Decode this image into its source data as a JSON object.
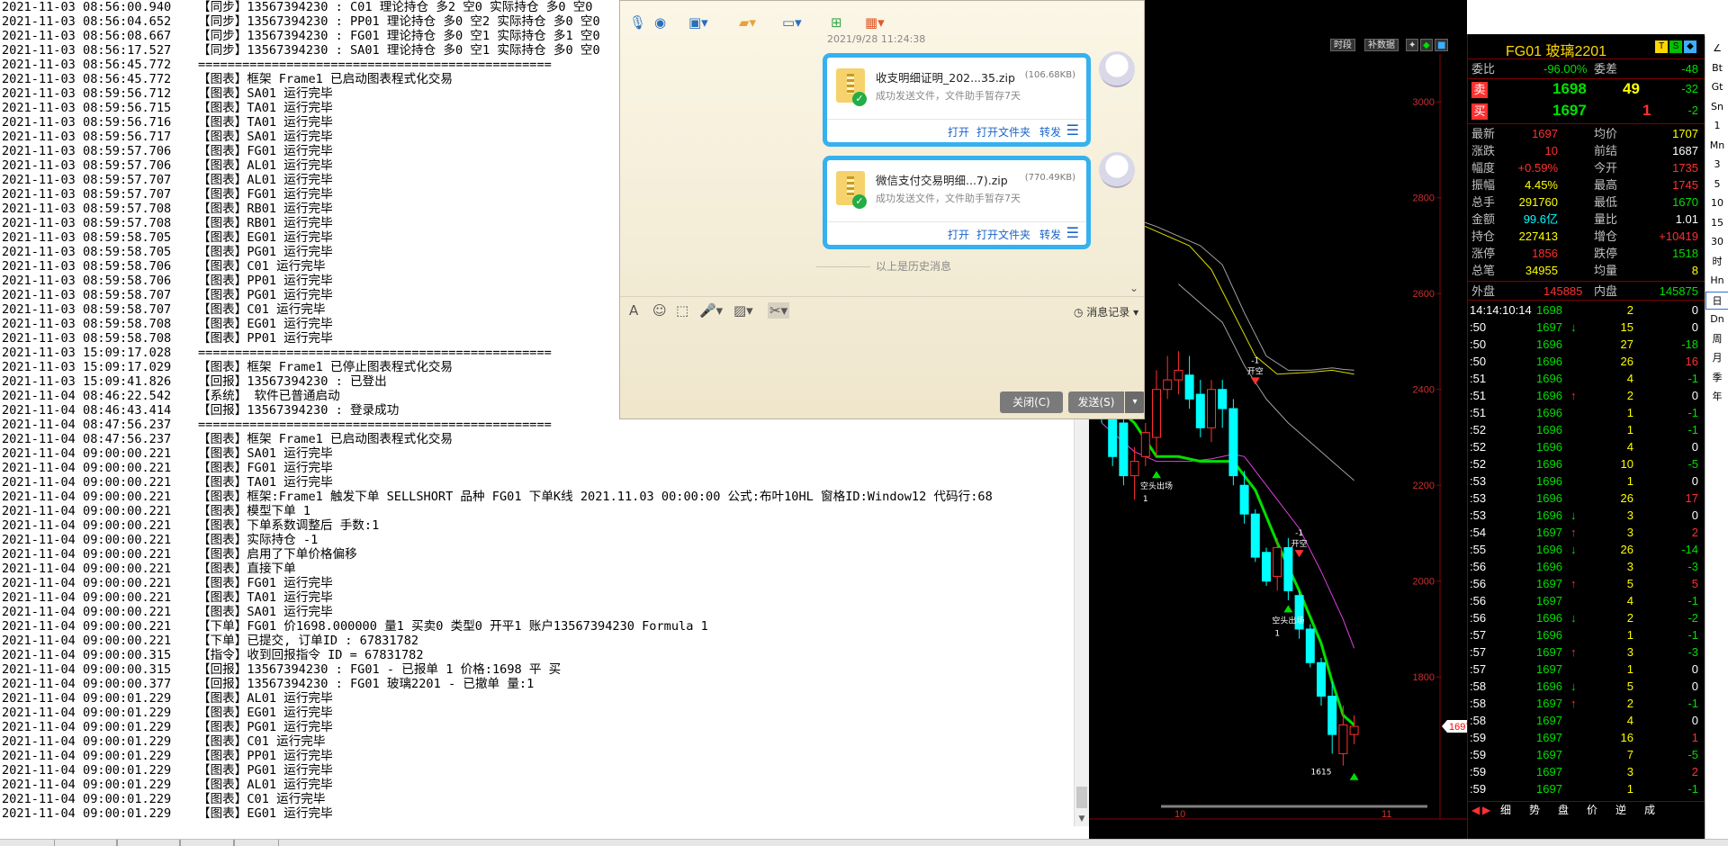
{
  "log": {
    "lines": [
      {
        "ts": "2021-11-03 08:56:00.940",
        "msg": "【同步】13567394230 : C01 理论持仓 多2 空0 实际持仓 多0 空0"
      },
      {
        "ts": "2021-11-03 08:56:04.652",
        "msg": "【同步】13567394230 : PP01 理论持仓 多0 空2 实际持仓 多0 空0"
      },
      {
        "ts": "2021-11-03 08:56:08.667",
        "msg": "【同步】13567394230 : FG01 理论持仓 多0 空1 实际持仓 多1 空0"
      },
      {
        "ts": "2021-11-03 08:56:17.527",
        "msg": "【同步】13567394230 : SA01 理论持仓 多0 空1 实际持仓 多0 空0"
      },
      {
        "ts": "2021-11-03 08:56:45.772",
        "msg": "================================================"
      },
      {
        "ts": "2021-11-03 08:56:45.772",
        "msg": "【图表】框架 Frame1 已启动图表程式化交易"
      },
      {
        "ts": "2021-11-03 08:59:56.712",
        "msg": "【图表】SA01 运行完毕"
      },
      {
        "ts": "2021-11-03 08:59:56.715",
        "msg": "【图表】TA01 运行完毕"
      },
      {
        "ts": "2021-11-03 08:59:56.716",
        "msg": "【图表】TA01 运行完毕"
      },
      {
        "ts": "2021-11-03 08:59:56.717",
        "msg": "【图表】SA01 运行完毕"
      },
      {
        "ts": "2021-11-03 08:59:57.706",
        "msg": "【图表】FG01 运行完毕"
      },
      {
        "ts": "2021-11-03 08:59:57.706",
        "msg": "【图表】AL01 运行完毕"
      },
      {
        "ts": "2021-11-03 08:59:57.707",
        "msg": "【图表】AL01 运行完毕"
      },
      {
        "ts": "2021-11-03 08:59:57.707",
        "msg": "【图表】FG01 运行完毕"
      },
      {
        "ts": "2021-11-03 08:59:57.708",
        "msg": "【图表】RB01 运行完毕"
      },
      {
        "ts": "2021-11-03 08:59:57.708",
        "msg": "【图表】RB01 运行完毕"
      },
      {
        "ts": "2021-11-03 08:59:58.705",
        "msg": "【图表】EG01 运行完毕"
      },
      {
        "ts": "2021-11-03 08:59:58.705",
        "msg": "【图表】PG01 运行完毕"
      },
      {
        "ts": "2021-11-03 08:59:58.706",
        "msg": "【图表】C01 运行完毕"
      },
      {
        "ts": "2021-11-03 08:59:58.706",
        "msg": "【图表】PP01 运行完毕"
      },
      {
        "ts": "2021-11-03 08:59:58.707",
        "msg": "【图表】PG01 运行完毕"
      },
      {
        "ts": "2021-11-03 08:59:58.707",
        "msg": "【图表】C01 运行完毕"
      },
      {
        "ts": "2021-11-03 08:59:58.708",
        "msg": "【图表】EG01 运行完毕"
      },
      {
        "ts": "2021-11-03 08:59:58.708",
        "msg": "【图表】PP01 运行完毕"
      },
      {
        "ts": "2021-11-03 15:09:17.028",
        "msg": "================================================"
      },
      {
        "ts": "2021-11-03 15:09:17.029",
        "msg": "【图表】框架 Frame1 已停止图表程式化交易"
      },
      {
        "ts": "2021-11-03 15:09:41.826",
        "msg": "【回报】13567394230 : 已登出"
      },
      {
        "ts": "2021-11-04 08:46:22.542",
        "msg": "【系统】 软件已普通启动"
      },
      {
        "ts": "2021-11-04 08:46:43.414",
        "msg": "【回报】13567394230 : 登录成功"
      },
      {
        "ts": "2021-11-04 08:47:56.237",
        "msg": "================================================"
      },
      {
        "ts": "2021-11-04 08:47:56.237",
        "msg": "【图表】框架 Frame1 已启动图表程式化交易"
      },
      {
        "ts": "2021-11-04 09:00:00.221",
        "msg": "【图表】SA01 运行完毕"
      },
      {
        "ts": "2021-11-04 09:00:00.221",
        "msg": "【图表】FG01 运行完毕"
      },
      {
        "ts": "2021-11-04 09:00:00.221",
        "msg": "【图表】TA01 运行完毕"
      },
      {
        "ts": "2021-11-04 09:00:00.221",
        "msg": "【图表】框架:Frame1 触发下单 SELLSHORT 品种 FG01 下单K线 2021.11.03 00:00:00 公式:布叶10HL 窗格ID:Window12 代码行:68"
      },
      {
        "ts": "2021-11-04 09:00:00.221",
        "msg": "【图表】模型下单 1"
      },
      {
        "ts": "2021-11-04 09:00:00.221",
        "msg": "【图表】下单系数调整后 手数:1"
      },
      {
        "ts": "2021-11-04 09:00:00.221",
        "msg": "【图表】实际持仓 -1"
      },
      {
        "ts": "2021-11-04 09:00:00.221",
        "msg": "【图表】启用了下单价格偏移"
      },
      {
        "ts": "2021-11-04 09:00:00.221",
        "msg": "【图表】直接下单"
      },
      {
        "ts": "2021-11-04 09:00:00.221",
        "msg": "【图表】FG01 运行完毕"
      },
      {
        "ts": "2021-11-04 09:00:00.221",
        "msg": "【图表】TA01 运行完毕"
      },
      {
        "ts": "2021-11-04 09:00:00.221",
        "msg": "【图表】SA01 运行完毕"
      },
      {
        "ts": "2021-11-04 09:00:00.221",
        "msg": "【下单】FG01 价1698.000000 量1 买卖0 类型0 开平1 账户13567394230 Formula 1"
      },
      {
        "ts": "2021-11-04 09:00:00.221",
        "msg": "【下单】已提交, 订单ID : 67831782"
      },
      {
        "ts": "2021-11-04 09:00:00.315",
        "msg": "【指令】收到回报指令 ID = 67831782"
      },
      {
        "ts": "2021-11-04 09:00:00.315",
        "msg": "【回报】13567394230 : FG01 - 已报单 1 价格:1698 平 买"
      },
      {
        "ts": "2021-11-04 09:00:00.377",
        "msg": "【回报】13567394230 : FG01 玻璃2201 - 已撤单 量:1"
      },
      {
        "ts": "2021-11-04 09:00:01.229",
        "msg": "【图表】AL01 运行完毕"
      },
      {
        "ts": "2021-11-04 09:00:01.229",
        "msg": "【图表】EG01 运行完毕"
      },
      {
        "ts": "2021-11-04 09:00:01.229",
        "msg": "【图表】PG01 运行完毕"
      },
      {
        "ts": "2021-11-04 09:00:01.229",
        "msg": "【图表】C01 运行完毕"
      },
      {
        "ts": "2021-11-04 09:00:01.229",
        "msg": "【图表】PP01 运行完毕"
      },
      {
        "ts": "2021-11-04 09:00:01.229",
        "msg": "【图表】PG01 运行完毕"
      },
      {
        "ts": "2021-11-04 09:00:01.229",
        "msg": "【图表】AL01 运行完毕"
      },
      {
        "ts": "2021-11-04 09:00:01.229",
        "msg": "【图表】C01 运行完毕"
      },
      {
        "ts": "2021-11-04 09:00:01.229",
        "msg": "【图表】EG01 运行完毕"
      }
    ]
  },
  "chat": {
    "date": "2021/9/28 11:24:38",
    "files": [
      {
        "name": "收支明细证明_202...35.zip",
        "size": "(106.68KB)",
        "status": "成功发送文件，文件助手暂存7天"
      },
      {
        "name": "微信支付交易明细...7).zip",
        "size": "(770.49KB)",
        "status": "成功发送文件，文件助手暂存7天"
      }
    ],
    "file_actions": {
      "open": "打开",
      "open_folder": "打开文件夹",
      "forward": "转发"
    },
    "history_note": "以上是历史消息",
    "msg_record": "消息记录",
    "close_label": "关闭(C)",
    "send_label": "发送(S)"
  },
  "chart": {
    "toolbar": {
      "btn1": "时段",
      "btn2": "补数据"
    },
    "price_labels": [
      "3000",
      "2800",
      "2600",
      "2400",
      "2200",
      "2000",
      "1800"
    ],
    "x_labels": [
      "10",
      "11"
    ],
    "current_price_tag": "1697",
    "annotations": {
      "open_short_1": "开空",
      "open_short_2": "开空",
      "cover_1": "空头出场",
      "cover_2": "空头出场",
      "minus1_a": "-1",
      "minus1_b": "-1",
      "one_a": "1",
      "one_b": "1",
      "low_value": "1615"
    },
    "colors": {
      "up": "#ff3030",
      "down": "#00ffff",
      "ma_yellow": "#d8d800",
      "ma_magenta": "#e040e0",
      "ma_gray": "#a0a0a0",
      "ma_green": "#00e000"
    }
  },
  "quote": {
    "title": "FG01  玻璃2201",
    "wb": {
      "label": "委比",
      "pct": "-96.00%",
      "wc_label": "委差",
      "wc": "-48"
    },
    "ask": {
      "label": "卖",
      "price": "1698",
      "vol": "49",
      "chg": "-32"
    },
    "bid": {
      "label": "买",
      "price": "1697",
      "vol": "1",
      "chg": "-2"
    },
    "stats": [
      {
        "l1": "最新",
        "v1": "1697",
        "l2": "均价",
        "v2": "1707"
      },
      {
        "l1": "涨跌",
        "v1": "10",
        "l2": "前结",
        "v2": "1687"
      },
      {
        "l1": "幅度",
        "v1": "+0.59%",
        "l2": "今开",
        "v2": "1735"
      },
      {
        "l1": "振幅",
        "v1": "4.45%",
        "l2": "最高",
        "v2": "1745"
      },
      {
        "l1": "总手",
        "v1": "291760",
        "l2": "最低",
        "v2": "1670"
      },
      {
        "l1": "金额",
        "v1": "99.6亿",
        "l2": "量比",
        "v2": "1.01"
      },
      {
        "l1": "持仓",
        "v1": "227413",
        "l2": "增仓",
        "v2": "+10419"
      },
      {
        "l1": "涨停",
        "v1": "1856",
        "l2": "跌停",
        "v2": "1518"
      },
      {
        "l1": "总笔",
        "v1": "34955",
        "l2": "均量",
        "v2": "8"
      }
    ],
    "outer": {
      "label": "外盘",
      "value": "145885",
      "inner_label": "内盘",
      "inner_value": "145875"
    },
    "ticks": [
      {
        "t": "14:14:10:14",
        "p": "1698",
        "a": "",
        "v": "2",
        "c": "0"
      },
      {
        "t": ":50",
        "p": "1697",
        "a": "↓",
        "v": "15",
        "c": "0"
      },
      {
        "t": ":50",
        "p": "1696",
        "a": "",
        "v": "27",
        "c": "-18"
      },
      {
        "t": ":50",
        "p": "1696",
        "a": "",
        "v": "26",
        "c": "16"
      },
      {
        "t": ":51",
        "p": "1696",
        "a": "",
        "v": "4",
        "c": "-1"
      },
      {
        "t": ":51",
        "p": "1696",
        "a": "↑",
        "v": "2",
        "c": "0"
      },
      {
        "t": ":51",
        "p": "1696",
        "a": "",
        "v": "1",
        "c": "-1"
      },
      {
        "t": ":52",
        "p": "1696",
        "a": "",
        "v": "1",
        "c": "-1"
      },
      {
        "t": ":52",
        "p": "1696",
        "a": "",
        "v": "4",
        "c": "0"
      },
      {
        "t": ":52",
        "p": "1696",
        "a": "",
        "v": "10",
        "c": "-5"
      },
      {
        "t": ":53",
        "p": "1696",
        "a": "",
        "v": "1",
        "c": "0"
      },
      {
        "t": ":53",
        "p": "1696",
        "a": "",
        "v": "26",
        "c": "17"
      },
      {
        "t": ":53",
        "p": "1696",
        "a": "↓",
        "v": "3",
        "c": "0"
      },
      {
        "t": ":54",
        "p": "1697",
        "a": "↑",
        "v": "3",
        "c": "2"
      },
      {
        "t": ":55",
        "p": "1696",
        "a": "↓",
        "v": "26",
        "c": "-14"
      },
      {
        "t": ":56",
        "p": "1696",
        "a": "",
        "v": "3",
        "c": "-3"
      },
      {
        "t": ":56",
        "p": "1697",
        "a": "↑",
        "v": "5",
        "c": "5"
      },
      {
        "t": ":56",
        "p": "1697",
        "a": "",
        "v": "4",
        "c": "-1"
      },
      {
        "t": ":56",
        "p": "1696",
        "a": "↓",
        "v": "2",
        "c": "-2"
      },
      {
        "t": ":57",
        "p": "1696",
        "a": "",
        "v": "1",
        "c": "-1"
      },
      {
        "t": ":57",
        "p": "1697",
        "a": "↑",
        "v": "3",
        "c": "-3"
      },
      {
        "t": ":57",
        "p": "1697",
        "a": "",
        "v": "1",
        "c": "0"
      },
      {
        "t": ":58",
        "p": "1696",
        "a": "↓",
        "v": "5",
        "c": "0"
      },
      {
        "t": ":58",
        "p": "1697",
        "a": "↑",
        "v": "2",
        "c": "-1"
      },
      {
        "t": ":58",
        "p": "1697",
        "a": "",
        "v": "4",
        "c": "0"
      },
      {
        "t": ":59",
        "p": "1697",
        "a": "",
        "v": "16",
        "c": "1"
      },
      {
        "t": ":59",
        "p": "1697",
        "a": "",
        "v": "7",
        "c": "-5"
      },
      {
        "t": ":59",
        "p": "1697",
        "a": "",
        "v": "3",
        "c": "2"
      },
      {
        "t": ":59",
        "p": "1697",
        "a": "",
        "v": "1",
        "c": "-1"
      }
    ],
    "tabs": [
      "细",
      "势",
      "盘",
      "价",
      "逆",
      "成"
    ]
  },
  "right_nav": [
    "∠",
    "Bt",
    "Gt",
    "Sn",
    "1",
    "Mn",
    "3",
    "5",
    "10",
    "15",
    "30",
    "时",
    "Hn",
    "日",
    "Dn",
    "周",
    "月",
    "季",
    "年"
  ]
}
